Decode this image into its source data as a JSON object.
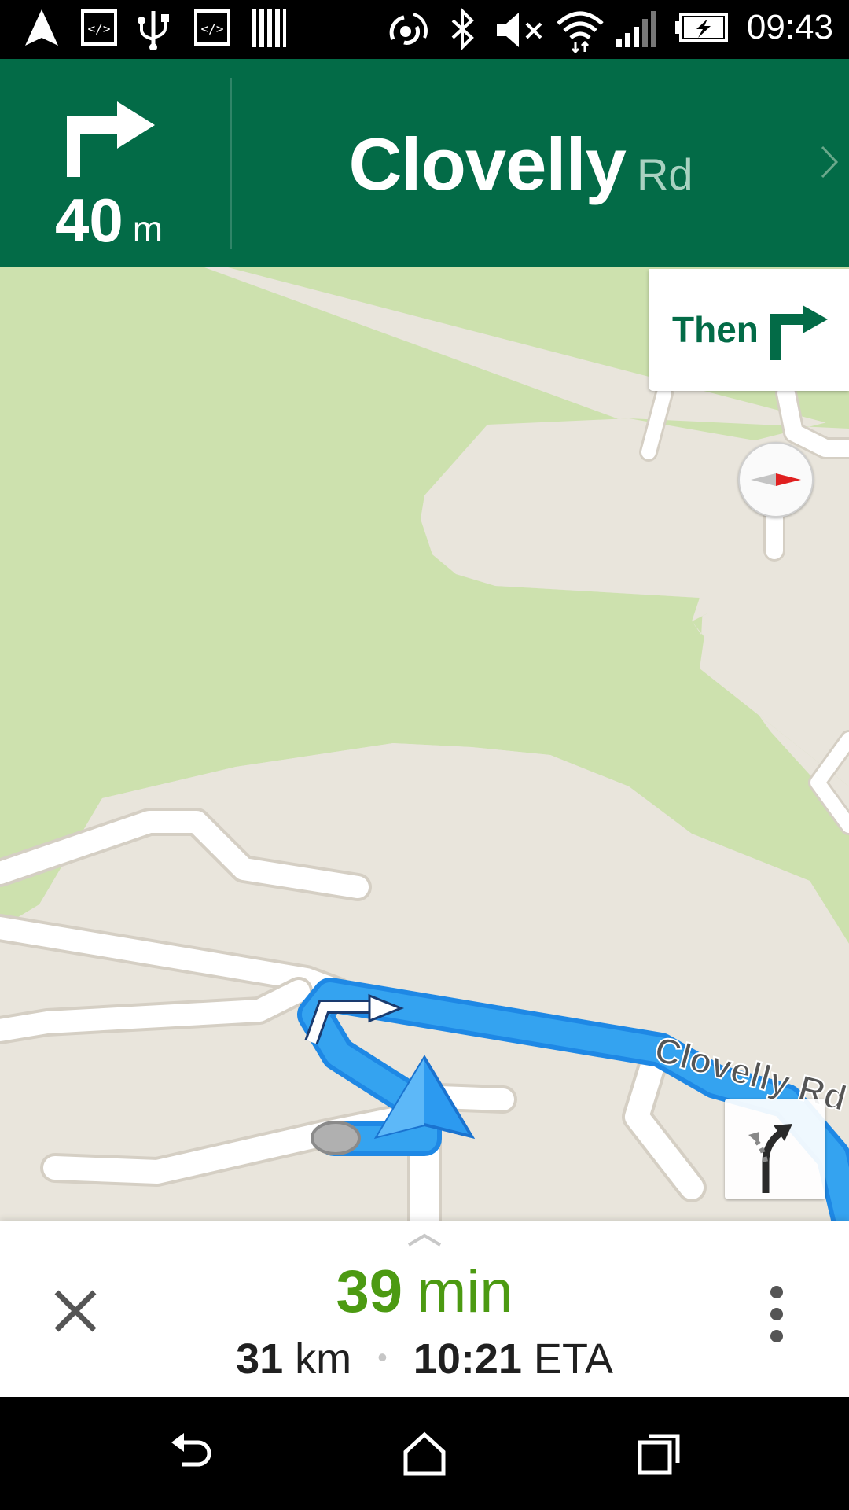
{
  "status_bar": {
    "time": "09:43",
    "left_icons": [
      "navigation-icon",
      "developer-code-icon",
      "usb-icon",
      "developer-code-icon",
      "barcode-icon"
    ],
    "right_icons": [
      "nfc-icon",
      "bluetooth-icon",
      "volume-muted-icon",
      "wifi-icon",
      "signal-icon",
      "battery-charging-icon"
    ]
  },
  "header": {
    "maneuver_icon": "turn-right-icon",
    "distance_value": "40",
    "distance_unit": "m",
    "street_name": "Clovelly",
    "street_suffix": "Rd",
    "background_color": "#036b47"
  },
  "then_card": {
    "label": "Then",
    "icon": "turn-right-icon"
  },
  "map": {
    "road_label": "Clovelly Rd",
    "route_color": "#2196f3",
    "park_color": "#cde1ae",
    "ground_color": "#e9e5dc"
  },
  "bottom_panel": {
    "duration_value": "39",
    "duration_unit": "min",
    "distance_value": "31",
    "distance_unit": "km",
    "separator": "•",
    "eta_time": "10:21",
    "eta_label": "ETA",
    "duration_color": "#4c9a12"
  },
  "nav_bar": {
    "buttons": [
      "back-icon",
      "home-icon",
      "recent-apps-icon"
    ]
  }
}
